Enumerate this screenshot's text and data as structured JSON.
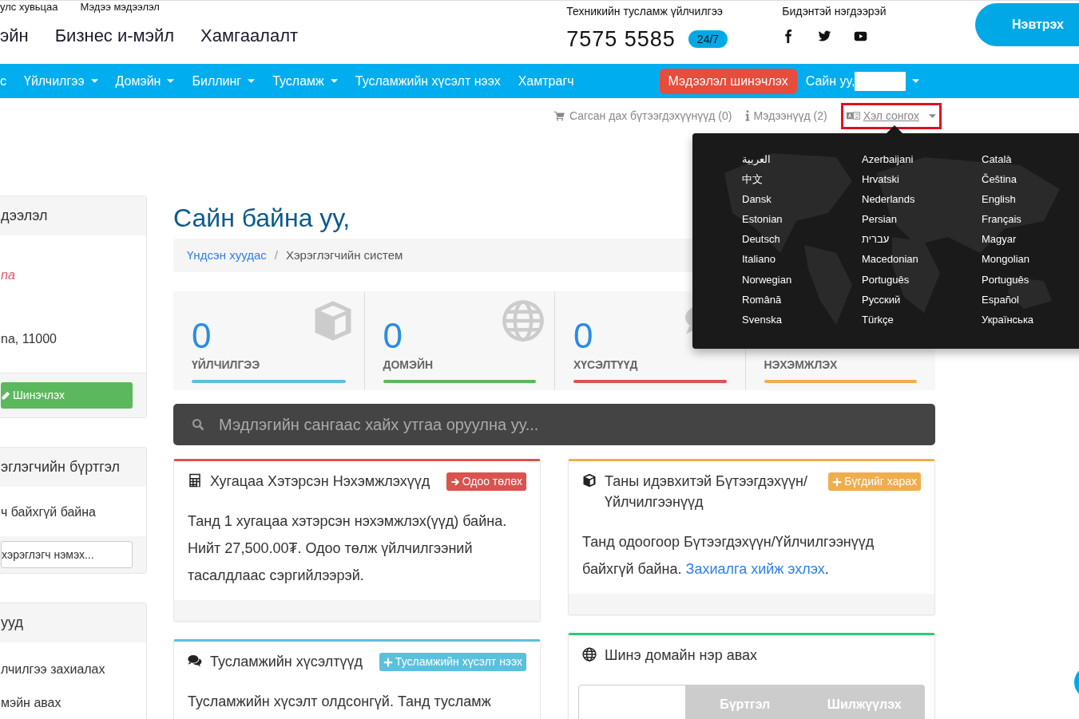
{
  "header": {
    "top_links": [
      "улс хувьцаа",
      "Мэдээ мэдээлэл"
    ],
    "main_links": [
      "эйн",
      "Бизнес и-мэйл",
      "Хамгаалалт"
    ],
    "support": {
      "label": "Техникийн тусламж үйлчилгээ",
      "phone": "7575 5585",
      "badge": "24/7"
    },
    "social": {
      "label": "Бидэнтэй нэгдээрэй",
      "icons": [
        {
          "kind": "facebook"
        },
        {
          "kind": "twitter"
        },
        {
          "kind": "youtube"
        }
      ]
    },
    "login_button": "Нэвтрэх"
  },
  "navbar": {
    "items": [
      {
        "label": "с",
        "has_menu": false
      },
      {
        "label": "Үйлчилгээ",
        "has_menu": true
      },
      {
        "label": "Домэйн",
        "has_menu": true
      },
      {
        "label": "Биллинг",
        "has_menu": true
      },
      {
        "label": "Тусламж",
        "has_menu": true
      },
      {
        "label": "Тусламжийн хүсэлт нээх",
        "has_menu": false
      },
      {
        "label": "Хамтрагч",
        "has_menu": false
      }
    ],
    "update_button": "Мэдээлэл шинэчлэх",
    "greeting": "Сайн уу,"
  },
  "subbar": [
    {
      "kind": "cart",
      "label": "Сагсан дах бүтээгдэхүүнүүд (0)",
      "highlighted": false,
      "has_menu": false
    },
    {
      "kind": "info",
      "label": "Мэдээнүүд (2)",
      "highlighted": false,
      "has_menu": false
    },
    {
      "kind": "language",
      "label": "Хэл сонгох",
      "highlighted": true,
      "has_menu": true
    }
  ],
  "language_menu": [
    "العربية",
    "中文",
    "Dansk",
    "Estonian",
    "Deutsch",
    "Italiano",
    "Norwegian",
    "Română",
    "Svenska",
    "Azerbaijani",
    "Hrvatski",
    "Nederlands",
    "Persian",
    "עברית",
    "Macedonian",
    "Português",
    "Русский",
    "Türkçe",
    "Català",
    "Čeština",
    "English",
    "Français",
    "Magyar",
    "Mongolian",
    "Português",
    "Español",
    "Українська"
  ],
  "sidebar": [
    {
      "title": "дээлэл",
      "kind": "info",
      "lines": [
        {
          "text": "na",
          "italic": true
        },
        {
          "text": "na, 11000",
          "italic": false
        }
      ],
      "button": "Шинэчлэх"
    },
    {
      "title": "эглэгчийн бүртгэл",
      "kind": "contacts",
      "lines": [
        {
          "text": "ч байхгүй байна",
          "italic": false
        }
      ],
      "placeholder": "хэрэглэгч нэмэх..."
    },
    {
      "title": "ууд",
      "kind": "links",
      "links": [
        "лчилгээ захиалах",
        "мэйн авах"
      ]
    }
  ],
  "page_title": "Сайн байна уу,",
  "breadcrumb": [
    {
      "label": "Үндсэн хуудас",
      "link": true
    },
    {
      "separator": "/",
      "label": "Хэрэглэгчийн систем",
      "link": false
    }
  ],
  "stats": [
    {
      "kind": "cube",
      "value": "0",
      "label": "ҮЙЛЧИЛГЭЭ",
      "color": "#5bc0de"
    },
    {
      "kind": "globe",
      "value": "0",
      "label": "ДОМЭЙН",
      "color": "#5cb85c"
    },
    {
      "kind": "comments",
      "value": "0",
      "label": "ХҮСЭЛТҮҮД",
      "color": "#d9534f"
    },
    {
      "kind": "none",
      "label": "НЭХЭМЖЛЭХ",
      "color": "#f0ad4e"
    }
  ],
  "kb_search": {
    "placeholder": "Мэдлэгийн сангаас хайх утгаа оруулна уу..."
  },
  "card_columns": [
    [
      {
        "kind": "calculator",
        "title": "Хугацаа Хэтэрсэн Нэхэмжлэхүүд",
        "color": "#d9534f",
        "badge": {
          "kind": "arrow",
          "label": "Одоо төлөх"
        },
        "body": "Танд 1 хугацаа хэтэрсэн нэхэмжлэх(үүд) байна. Нийт 27,500.00₮. Одоо төлж үйлчилгээний тасалдлаас сэргийлээрэй.",
        "footer": true
      },
      {
        "kind": "comments",
        "title": "Тусламжийн хүсэлтүүд",
        "color": "#5bc0de",
        "badge": {
          "kind": "plus",
          "label": "Тусламжийн хүсэлт нээх"
        },
        "body": "Тусламжийн хүсэлт олдсонгүй. Танд тусламж",
        "footer": false
      }
    ],
    [
      {
        "kind": "cube",
        "title": "Таны идэвхитэй Бүтээгдэхүүн/ Үйлчилгээнүүд",
        "color": "#f0ad4e",
        "badge": {
          "kind": "plus",
          "label": "Бүгдийг харах"
        },
        "body": "Танд одоогоор Бүтээгдэхүүн/Үйлчилгээнүүд байхгүй байна.",
        "link": "Захиалга хийж эхлэх",
        "after": ".",
        "footer": true
      },
      {
        "kind": "globe",
        "title": "Шинэ домайн нэр авах",
        "color": "#2ecc71",
        "domain_buttons": [
          "Бүртгэл",
          "Шилжүүлэх"
        ],
        "footer": false
      }
    ]
  ]
}
